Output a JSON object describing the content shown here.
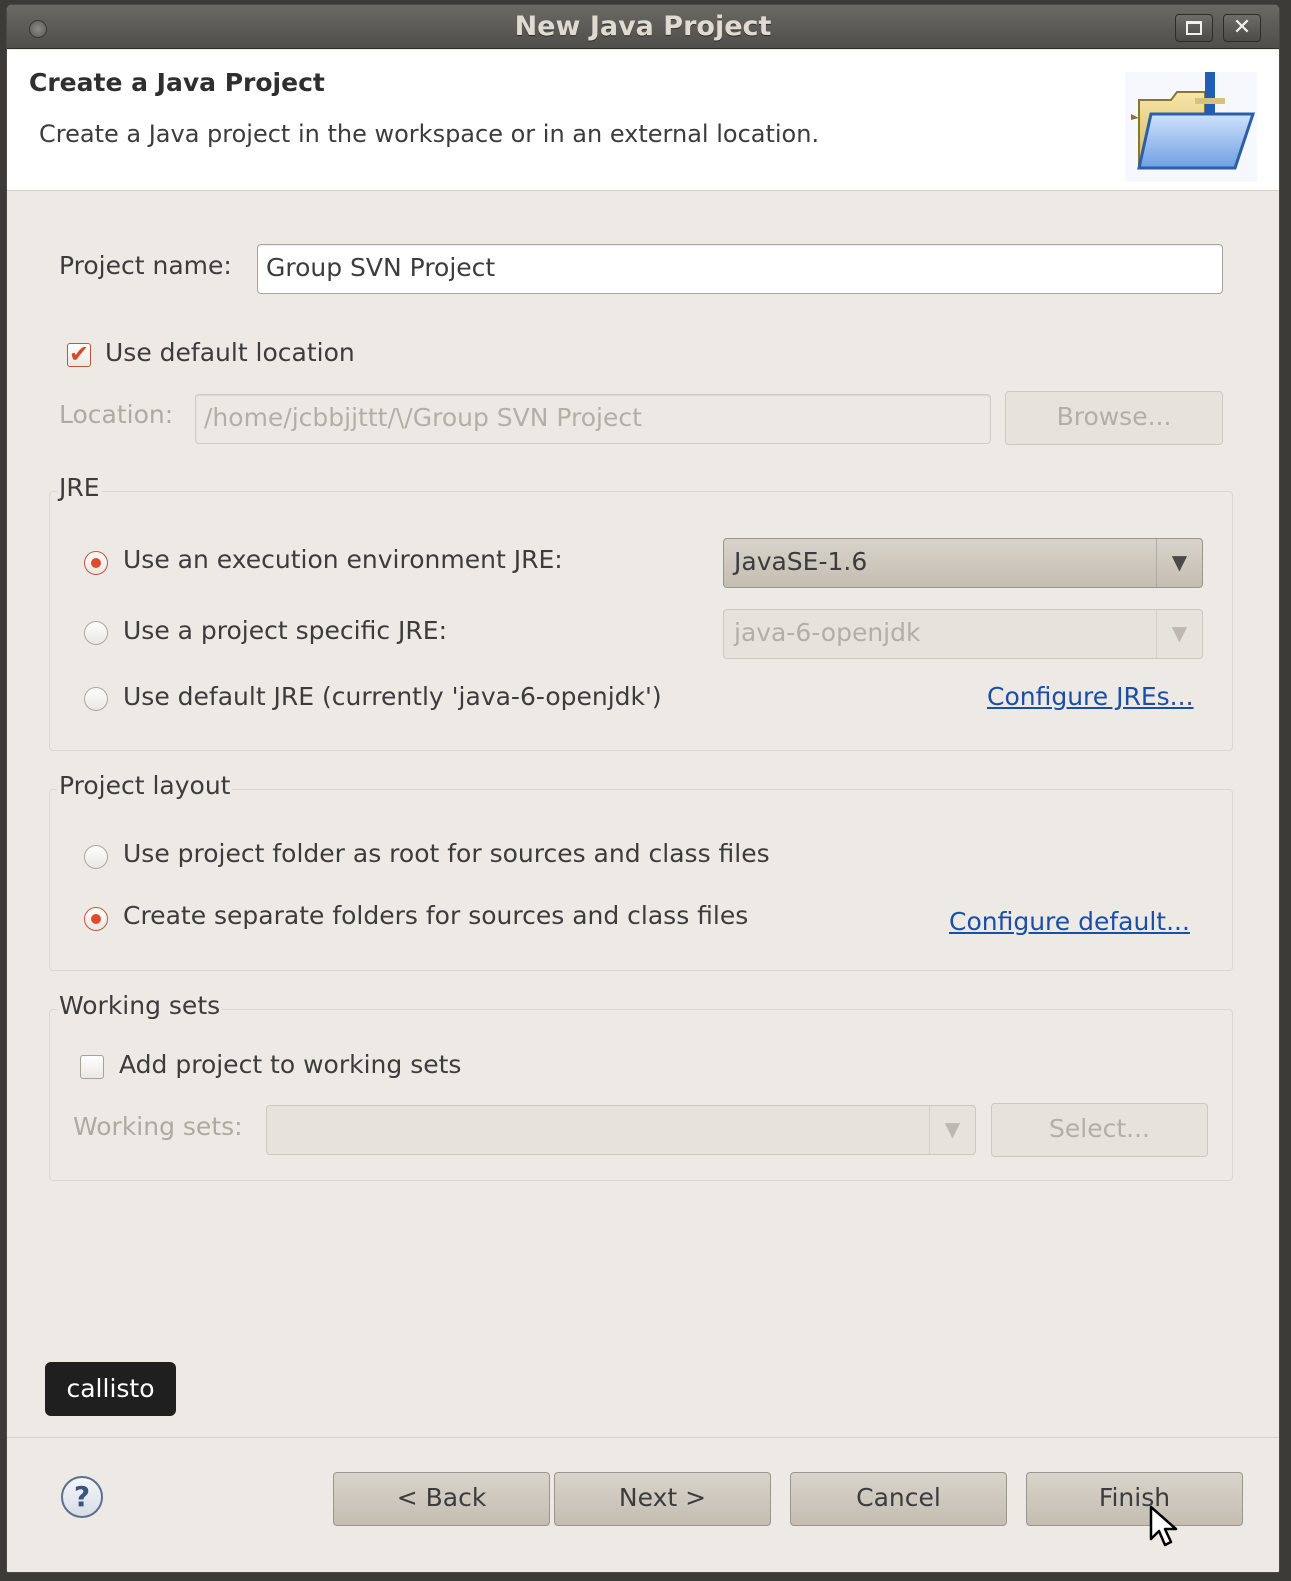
{
  "window": {
    "title": "New Java Project",
    "maximize_icon": "maximize-icon",
    "close_icon": "close-icon"
  },
  "header": {
    "title": "Create a Java Project",
    "description": "Create a Java project in the workspace or in an external location.",
    "icon": "java-project-folder-icon"
  },
  "form": {
    "project_name_label": "Project name:",
    "project_name_value": "Group SVN Project",
    "use_default_location_label": "Use default location",
    "use_default_location_checked": true,
    "location_label": "Location:",
    "location_value": "/home/jcbbjjttt/\\/Group SVN Project",
    "browse_label": "Browse..."
  },
  "jre": {
    "title": "JRE",
    "option_env_label": "Use an execution environment JRE:",
    "option_env_value": "JavaSE-1.6",
    "option_specific_label": "Use a project specific JRE:",
    "option_specific_value": "java-6-openjdk",
    "option_default_label": "Use default JRE (currently 'java-6-openjdk')",
    "configure_link": "Configure JREs...",
    "selected": "environment"
  },
  "layout": {
    "title": "Project layout",
    "option_root_label": "Use project folder as root for sources and class files",
    "option_separate_label": "Create separate folders for sources and class files",
    "configure_link": "Configure default...",
    "selected": "separate"
  },
  "working_sets": {
    "title": "Working sets",
    "add_label": "Add project to working sets",
    "add_checked": false,
    "sets_label": "Working sets:",
    "sets_value": "",
    "select_label": "Select..."
  },
  "badge": {
    "text": "callisto"
  },
  "footer": {
    "help_icon": "help-icon",
    "back_label": "< Back",
    "next_label": "Next >",
    "cancel_label": "Cancel",
    "finish_label": "Finish"
  },
  "colors": {
    "accent": "#e04b2a",
    "link": "#1a4fa8",
    "background": "#edeae5",
    "titlebar": "#5a5955"
  }
}
